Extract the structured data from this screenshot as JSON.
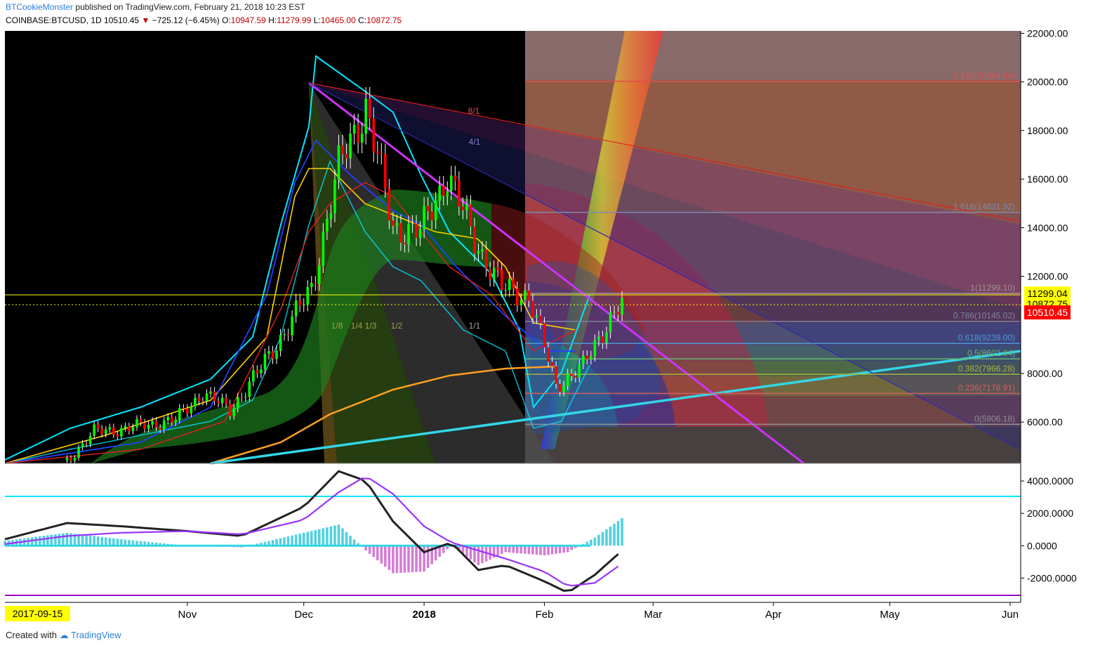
{
  "header": {
    "author": "BTCookieMonster",
    "published_text": "published on TradingView.com, February 21, 2018 10:23 EST",
    "symbol": "COINBASE:BTCUSD, 1D",
    "last": "10510.45",
    "change_arrow": "▼",
    "change": "−725.12 (−6.45%)",
    "open_label": "O:",
    "open": "10947.59",
    "high_label": "H:",
    "high": "11279.99",
    "low_label": "L:",
    "low": "10465.00",
    "close_label": "C:",
    "close": "10872.75"
  },
  "footer": {
    "created_with": "Created with",
    "brand": "TradingView"
  },
  "date_marker": "2017-09-15",
  "price_tags": [
    {
      "value": "11299.04",
      "bg": "#ffff00",
      "fg": "#000000"
    },
    {
      "value": "10872.75",
      "bg": "#ffff00",
      "fg": "#000000"
    },
    {
      "value": "10510.45",
      "bg": "#ff0000",
      "fg": "#ffffff"
    }
  ],
  "colors": {
    "background": "#000000",
    "bull_candle": "#00ff00",
    "bear_candle": "#ff0000",
    "downtrend_line": "#cc33ff",
    "uptrend_line": "#33d6e8",
    "ma_long": "#ffa020",
    "bollinger": "#00e5ff",
    "cloud_green": "#1c7a1c",
    "fib_box": "#b85a3a"
  },
  "chart_data": [
    {
      "type": "candlestick",
      "title": "",
      "xlabel": "",
      "ylabel": "",
      "x_tick_labels": [
        "Nov",
        "Dec",
        "2018",
        "Feb",
        "Mar",
        "Apr",
        "May",
        "Jun"
      ],
      "y_tick_labels": [
        "22000.00",
        "20000.00",
        "18000.00",
        "16000.00",
        "14000.00",
        "12000.00",
        "8000.00",
        "6000.00"
      ],
      "ylim": [
        4300,
        22100
      ],
      "grid": false,
      "fib_levels": [
        {
          "ratio": "2.618",
          "value": 20024.84,
          "label": "2.618(20024.84)",
          "color": "#e05050"
        },
        {
          "ratio": "1.618",
          "value": 14631.92,
          "label": "1.618(14631.92)",
          "color": "#7a8ab5"
        },
        {
          "ratio": "1",
          "value": 11299.1,
          "label": "1(11299.10)",
          "color": "#a09090"
        },
        {
          "ratio": "0.786",
          "value": 10145.02,
          "label": "0.786(10145.02)",
          "color": "#8080a0"
        },
        {
          "ratio": "0.618",
          "value": 9239.0,
          "label": "0.618(9239.00)",
          "color": "#4a9ad8"
        },
        {
          "ratio": "0.5",
          "value": 8602.64,
          "label": "0.5(8602.64)",
          "color": "#6ab86a"
        },
        {
          "ratio": "0.382",
          "value": 7966.28,
          "label": "0.382(7966.28)",
          "color": "#b0b040"
        },
        {
          "ratio": "0.236",
          "value": 7178.91,
          "label": "0.236(7178.91)",
          "color": "#d06060"
        },
        {
          "ratio": "0",
          "value": 5906.18,
          "label": "0(5906.18)",
          "color": "#909090"
        }
      ],
      "gann_fan_labels": [
        "8/1",
        "4/1",
        "1/1",
        "1/2",
        "1/3",
        "1/4",
        "1/8"
      ],
      "horizontal_lines": [
        11299.04,
        10872.75
      ],
      "series": [
        {
          "name": "",
          "type": "close",
          "dates": [
            "2017-10-01",
            "2017-10-08",
            "2017-10-15",
            "2017-10-22",
            "2017-10-29",
            "2017-11-05",
            "2017-11-12",
            "2017-11-19",
            "2017-11-26",
            "2017-12-03",
            "2017-12-10",
            "2017-12-17",
            "2017-12-24",
            "2017-12-31",
            "2018-01-07",
            "2018-01-14",
            "2018-01-21",
            "2018-01-28",
            "2018-02-04",
            "2018-02-11",
            "2018-02-18",
            "2018-02-21"
          ],
          "values": [
            4400,
            5600,
            5700,
            5900,
            6100,
            7200,
            6500,
            8000,
            9700,
            11500,
            16500,
            19000,
            14000,
            13800,
            16200,
            13500,
            11500,
            11200,
            7500,
            8300,
            10300,
            10872.75
          ]
        }
      ]
    },
    {
      "type": "macd",
      "title": "",
      "y_tick_labels": [
        "4000.0000",
        "2000.0000",
        "0.0000",
        "-2000.0000"
      ],
      "ylim": [
        -3500,
        5000
      ],
      "dates": [
        "2017-09-15",
        "2017-10-01",
        "2017-10-15",
        "2017-11-01",
        "2017-11-15",
        "2017-12-01",
        "2017-12-10",
        "2017-12-17",
        "2017-12-24",
        "2018-01-01",
        "2018-01-08",
        "2018-01-15",
        "2018-01-22",
        "2018-02-01",
        "2018-02-07",
        "2018-02-14",
        "2018-02-21"
      ],
      "series": [
        {
          "name": "",
          "values": [
            400,
            1400,
            1200,
            900,
            600,
            2400,
            4600,
            4000,
            1500,
            -400,
            200,
            -1500,
            -1200,
            -2200,
            -2900,
            -1800,
            -300
          ]
        },
        {
          "name": "",
          "values": [
            100,
            600,
            800,
            900,
            700,
            1600,
            3300,
            4300,
            3200,
            1200,
            200,
            -300,
            -800,
            -1600,
            -2500,
            -2300,
            -1100
          ]
        },
        {
          "name": "",
          "values": [
            300,
            800,
            400,
            0,
            -100,
            800,
            1300,
            -300,
            -1700,
            -1600,
            0,
            -1200,
            -400,
            -600,
            -400,
            500,
            1700
          ]
        }
      ]
    }
  ]
}
